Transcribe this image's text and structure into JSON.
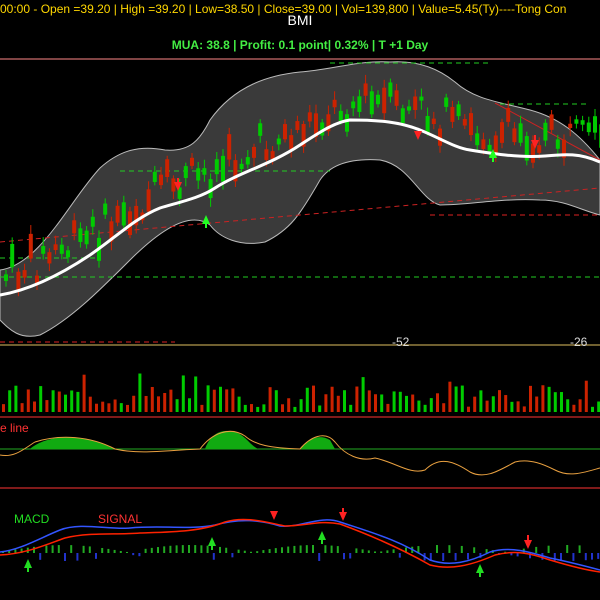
{
  "header": {
    "ohlc_text": "00:00 -  Open =39.20 | High =39.20 | Low=38.50 | Close=39.00 | Vol=139,800 | Value=5.45(Ty)----Tong Con",
    "symbol": "BMI",
    "mua_text": "MUA:  38.8  | Profit: 0.1 point| 0.32% | T +1 Day"
  },
  "price_panel": {
    "marker_left": "-52",
    "marker_right": "-26"
  },
  "trend_panel": {
    "label": "e line"
  },
  "macd_panel": {
    "macd_label": "MACD",
    "signal_label": "SIGNAL"
  },
  "colors": {
    "up": "#00cc00",
    "down": "#cc2200",
    "band": "#3a3a3a",
    "ma": "#ffffff",
    "macd": "#3355ff",
    "signal": "#ff2200",
    "trend": "#e8a040"
  }
}
